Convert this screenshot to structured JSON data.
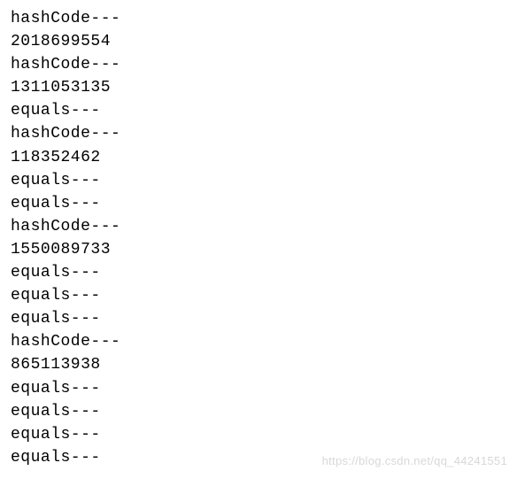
{
  "log_lines": [
    "hashCode---",
    "2018699554",
    "hashCode---",
    "1311053135",
    "equals---",
    "hashCode---",
    "118352462",
    "equals---",
    "equals---",
    "hashCode---",
    "1550089733",
    "equals---",
    "equals---",
    "equals---",
    "hashCode---",
    "865113938",
    "equals---",
    "equals---",
    "equals---",
    "equals---"
  ],
  "watermark": "https://blog.csdn.net/qq_44241551"
}
